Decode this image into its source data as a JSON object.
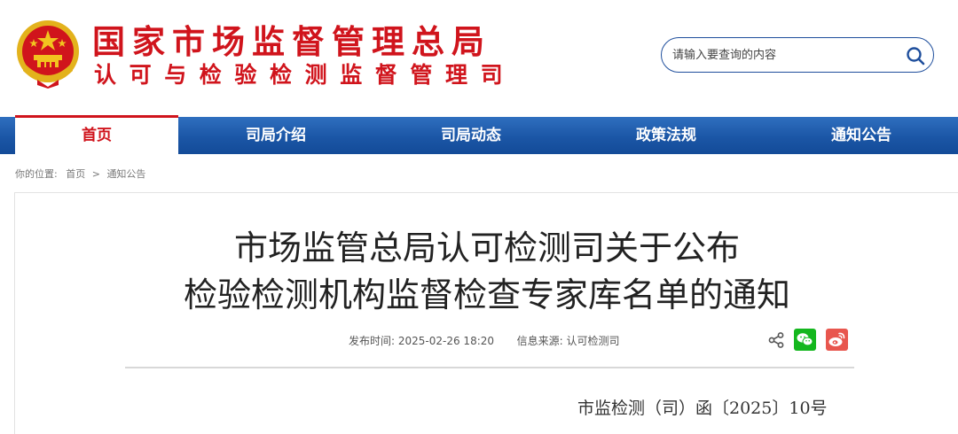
{
  "header": {
    "title_main": "国家市场监督管理总局",
    "title_sub": "认可与检验检测监督管理司",
    "brand_color": "#d0141c"
  },
  "search": {
    "placeholder": "请输入要查询的内容",
    "icon": "search-icon"
  },
  "nav": {
    "items": [
      {
        "label": "首页",
        "active": true
      },
      {
        "label": "司局介绍",
        "active": false
      },
      {
        "label": "司局动态",
        "active": false
      },
      {
        "label": "政策法规",
        "active": false
      },
      {
        "label": "通知公告",
        "active": false
      }
    ],
    "bar_color": "#1b56a6"
  },
  "breadcrumb": {
    "prefix": "你的位置:",
    "home": "首页",
    "separator": ">",
    "current": "通知公告"
  },
  "article": {
    "title_line1": "市场监管总局认可检测司关于公布",
    "title_line2": "检验检测机构监督检查专家库名单的通知",
    "publish_label": "发布时间:",
    "publish_time": "2025-02-26 18:20",
    "source_label": "信息来源:",
    "source": "认可检测司",
    "doc_number": "市监检测（司）函〔2025〕10号"
  },
  "share": {
    "icons": [
      "share-icon",
      "wechat-icon",
      "weibo-icon"
    ]
  }
}
